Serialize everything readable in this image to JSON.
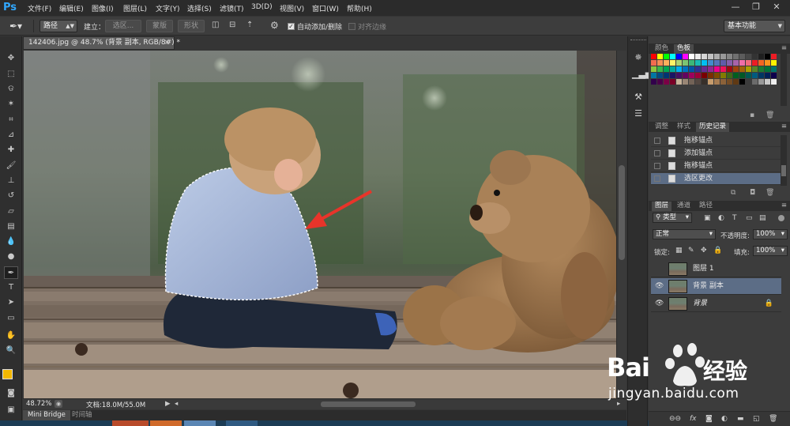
{
  "app": {
    "logo": "Ps"
  },
  "menu": [
    "文件(F)",
    "编辑(E)",
    "图像(I)",
    "图层(L)",
    "文字(Y)",
    "选择(S)",
    "滤镜(T)",
    "3D(D)",
    "视图(V)",
    "窗口(W)",
    "帮助(H)"
  ],
  "window_controls": {
    "minimize": "—",
    "restore": "❐",
    "close": "✕"
  },
  "options": {
    "mode_value": "路径",
    "make_label": "建立：",
    "selection_btn": "选区...",
    "mask_btn": "蒙版",
    "shape_btn": "形状",
    "auto_add_label": "自动添加/删除",
    "auto_add_checked": true,
    "align_edges_label": "对齐边缘",
    "align_edges_checked": false,
    "workspace": "基本功能"
  },
  "document": {
    "tab_title": "142406.jpg @ 48.7% (背景 副本, RGB/8#) *",
    "close": "×"
  },
  "status": {
    "zoom": "48.72%",
    "doc_size": "文档:18.0M/55.0M"
  },
  "bottom_tabs": [
    "Mini Bridge",
    "时间轴"
  ],
  "color_panel": {
    "tabs": [
      "颜色",
      "色板"
    ],
    "active": 1
  },
  "history_panel": {
    "tabs": [
      "调整",
      "样式",
      "历史记录"
    ],
    "active": 2,
    "items": [
      {
        "label": "拖移锚点",
        "selected": false
      },
      {
        "label": "添加锚点",
        "selected": false
      },
      {
        "label": "拖移锚点",
        "selected": false
      },
      {
        "label": "选区更改",
        "selected": true
      }
    ]
  },
  "layers_panel": {
    "tabs": [
      "图层",
      "通道",
      "路径"
    ],
    "active": 0,
    "kind_filter": "类型",
    "blend_mode": "正常",
    "opacity_label": "不透明度:",
    "opacity_value": "100%",
    "lock_label": "锁定:",
    "fill_label": "填充:",
    "fill_value": "100%",
    "layers": [
      {
        "name": "图层 1",
        "visible": false,
        "selected": false,
        "locked": false
      },
      {
        "name": "背景 副本",
        "visible": true,
        "selected": true,
        "locked": false
      },
      {
        "name": "背景",
        "visible": true,
        "selected": false,
        "locked": true
      }
    ]
  },
  "watermark": {
    "brand_latin": "Bai",
    "brand_cn": "经验",
    "url": "jingyan.baidu.com"
  },
  "colors": {
    "accent_ps": "#31a8ff",
    "selection_highlight": "#5c6d86",
    "foreground": "#f2b700",
    "background": "#111111",
    "arrow": "#e8342a"
  }
}
